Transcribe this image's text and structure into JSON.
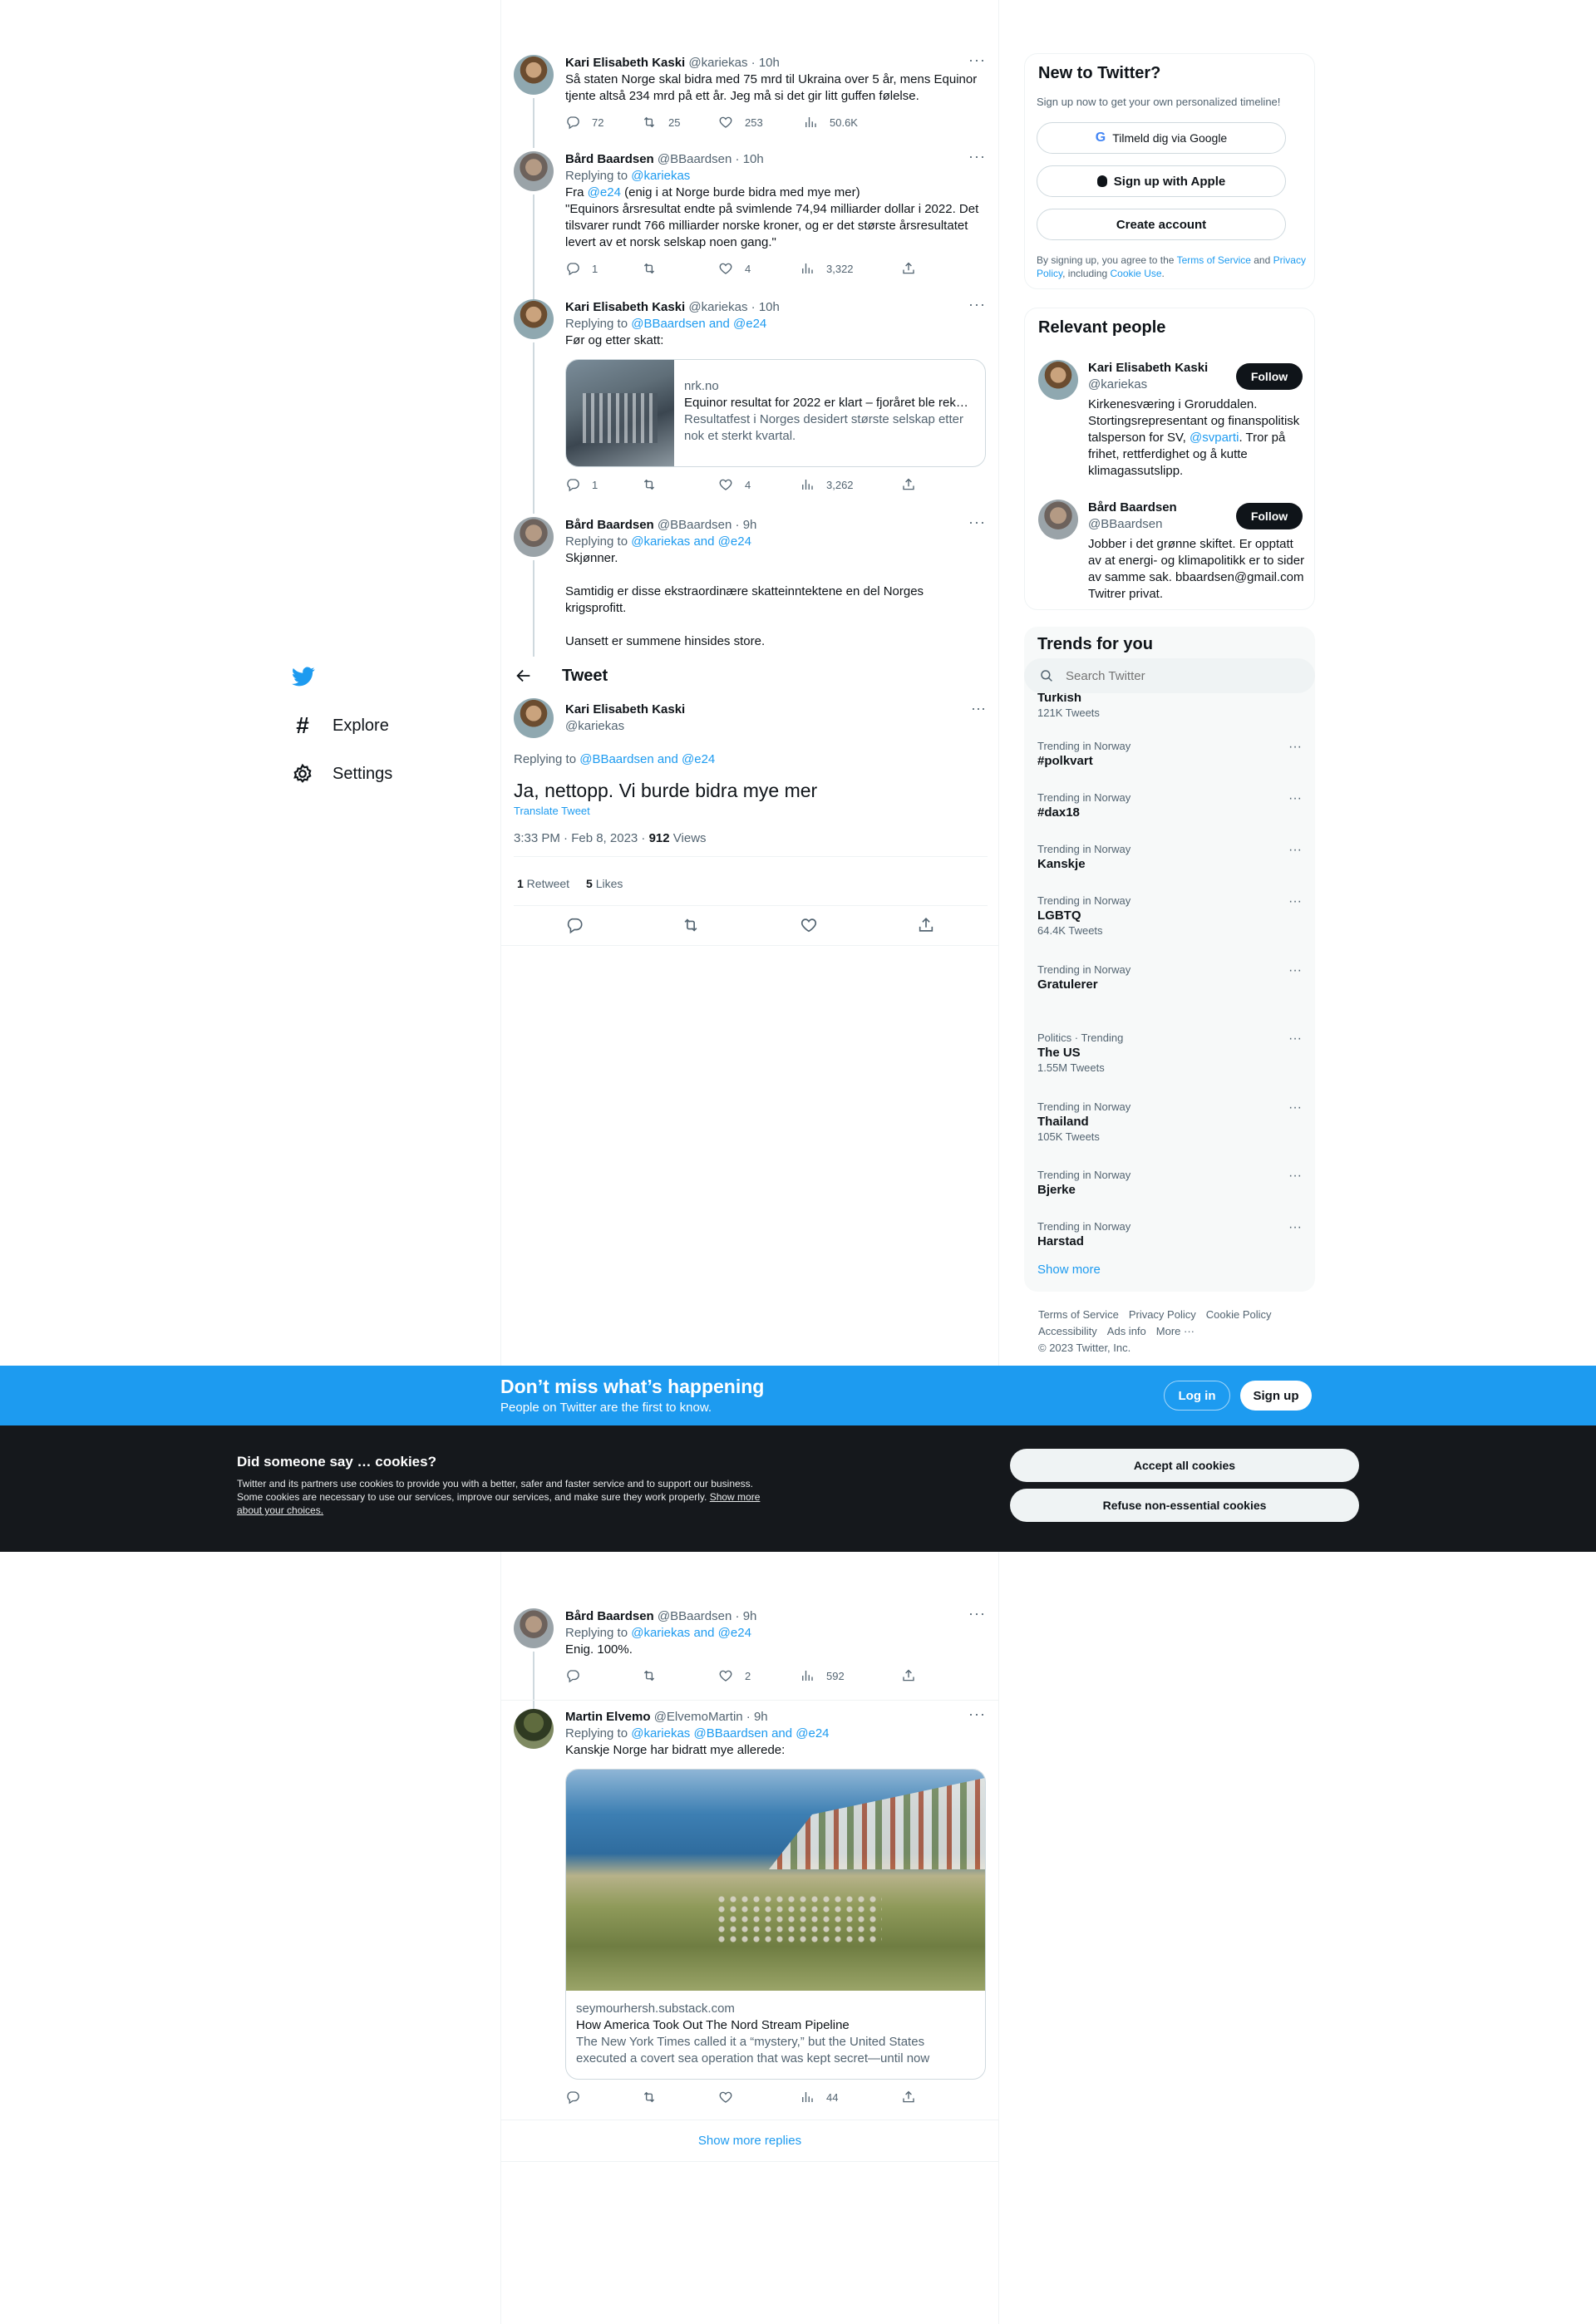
{
  "nav": {
    "explore": "Explore",
    "settings": "Settings"
  },
  "tweet_header": {
    "title": "Tweet"
  },
  "thread": [
    {
      "name": "Kari Elisabeth Kaski",
      "handle": "@kariekas",
      "time": "10h",
      "text": "Så staten Norge skal bidra med 75 mrd til Ukraina over 5 år, mens Equinor tjente altså 234 mrd på ett år. Jeg må si det gir litt guffen følelse.",
      "replies": "72",
      "retweets": "25",
      "likes": "253",
      "views": "50.6K"
    },
    {
      "name": "Bård Baardsen",
      "handle": "@BBaardsen",
      "time": "10h",
      "replying_label": "Replying to",
      "replying_to": "@kariekas",
      "text_pre": "Fra",
      "text_mention": "@e24",
      "text_post": "(enig i at Norge burde bidra med mye mer)",
      "text_quote": "\"Equinors årsresultat endte på svimlende 74,94 milliarder dollar i 2022. Det tilsvarer rundt 766 milliarder norske kroner, og er det største årsresultatet levert av et norsk selskap noen gang.\"",
      "replies": "1",
      "retweets": "",
      "likes": "4",
      "views": "3,322"
    },
    {
      "name": "Kari Elisabeth Kaski",
      "handle": "@kariekas",
      "time": "10h",
      "replying_label": "Replying to",
      "replying_to": "@BBaardsen and @e24",
      "text": "Før og etter skatt:",
      "card": {
        "domain": "nrk.no",
        "title": "Equinor resultat for 2022 er klart – fjoråret ble rek…",
        "desc": "Resultatfest i Norges desidert største selskap etter nok et sterkt kvartal."
      },
      "replies": "1",
      "retweets": "",
      "likes": "4",
      "views": "3,262"
    },
    {
      "name": "Bård Baardsen",
      "handle": "@BBaardsen",
      "time": "9h",
      "replying_label": "Replying to",
      "replying_to": "@kariekas and @e24",
      "p1": "Skjønner.",
      "p2": "Samtidig er disse ekstraordinære skatteinntektene en del Norges krigsprofitt.",
      "p3": "Uansett er summene hinsides store."
    }
  ],
  "main_tweet": {
    "name": "Kari Elisabeth Kaski",
    "handle": "@kariekas",
    "replying_label": "Replying to",
    "replying_to": "@BBaardsen and @e24",
    "text": "Ja, nettopp. Vi burde bidra mye mer",
    "translate": "Translate Tweet",
    "timestamp": "3:33 PM · Feb 8, 2023 · ",
    "views_count": "912",
    "views_label": " Views",
    "retweets_count": "1",
    "retweets_label": " Retweet",
    "likes_count": "5",
    "likes_label": " Likes"
  },
  "replies_below": [
    {
      "name": "Bård Baardsen",
      "handle": "@BBaardsen",
      "time": "9h",
      "replying_label": "Replying to",
      "replying_to": "@kariekas and @e24",
      "text": "Enig. 100%.",
      "replies": "",
      "retweets": "",
      "likes": "2",
      "views": "592"
    },
    {
      "name": "Martin Elvemo",
      "handle": "@ElvemoMartin",
      "time": "9h",
      "replying_label": "Replying to",
      "replying_to": "@kariekas @BBaardsen and @e24",
      "text": "Kanskje Norge har bidratt mye allerede:",
      "card": {
        "domain": "seymourhersh.substack.com",
        "title": "How America Took Out The Nord Stream Pipeline",
        "desc": "The New York Times called it a “mystery,” but the United States executed a covert sea operation that was kept secret—until now"
      },
      "replies": "",
      "retweets": "",
      "likes": "",
      "views": "44"
    }
  ],
  "show_more_replies": "Show more replies",
  "signup": {
    "title": "New to Twitter?",
    "subtitle": "Sign up now to get your own personalized timeline!",
    "google": "Tilmeld dig via Google",
    "apple": "Sign up with Apple",
    "create": "Create account",
    "legal_1": "By signing up, you agree to the ",
    "tos": "Terms of Service",
    "legal_2": " and ",
    "privacy": "Privacy Policy",
    "legal_3": ", including ",
    "cookie": "Cookie Use",
    "legal_4": "."
  },
  "relevant": {
    "title": "Relevant people",
    "people": [
      {
        "name": "Kari Elisabeth Kaski",
        "handle": "@kariekas",
        "follow": "Follow",
        "bio_pre": "Kirkenesværing i Groruddalen. Stortingsrepresentant og finanspolitisk talsperson for SV, ",
        "bio_mention": "@svparti",
        "bio_post": ". Tror på frihet, rettferdighet og å kutte klimagassutslipp."
      },
      {
        "name": "Bård Baardsen",
        "handle": "@BBaardsen",
        "follow": "Follow",
        "bio_pre": "Jobber i det grønne skiftet. Er opptatt av at energi- og klimapolitikk er to sider av samme sak. bbaardsen@gmail.com Twitrer privat.",
        "bio_mention": "",
        "bio_post": ""
      }
    ]
  },
  "search": {
    "placeholder": "Search Twitter"
  },
  "trends": {
    "title": "Trends for you",
    "first": {
      "topic": "Turkish",
      "count": "121K Tweets"
    },
    "items": [
      {
        "ctx": "Trending in Norway",
        "topic": "#polkvart",
        "count": ""
      },
      {
        "ctx": "Trending in Norway",
        "topic": "#dax18",
        "count": ""
      },
      {
        "ctx": "Trending in Norway",
        "topic": "Kanskje",
        "count": ""
      },
      {
        "ctx": "Trending in Norway",
        "topic": "LGBTQ",
        "count": "64.4K Tweets"
      },
      {
        "ctx": "Trending in Norway",
        "topic": "Gratulerer",
        "count": ""
      },
      {
        "ctx": "Politics · Trending",
        "topic": "The US",
        "count": "1.55M Tweets"
      },
      {
        "ctx": "Trending in Norway",
        "topic": "Thailand",
        "count": "105K Tweets"
      },
      {
        "ctx": "Trending in Norway",
        "topic": "Bjerke",
        "count": ""
      },
      {
        "ctx": "Trending in Norway",
        "topic": "Harstad",
        "count": ""
      }
    ],
    "show_more": "Show more"
  },
  "footer": {
    "tos": "Terms of Service",
    "privacy": "Privacy Policy",
    "cookie": "Cookie Policy",
    "accessibility": "Accessibility",
    "ads": "Ads info",
    "more": "More ···",
    "copyright": "© 2023 Twitter, Inc."
  },
  "banner": {
    "title": "Don’t miss what’s happening",
    "subtitle": "People on Twitter are the first to know.",
    "login": "Log in",
    "signup": "Sign up"
  },
  "cookies": {
    "title": "Did someone say … cookies?",
    "text": "Twitter and its partners use cookies to provide you with a better, safer and faster service and to support our business. Some cookies are necessary to use our services, improve our services, and make sure they work properly. ",
    "link": "Show more about your choices.",
    "accept": "Accept all cookies",
    "refuse": "Refuse non-essential cookies"
  },
  "colors": {
    "accent": "#1d9bf0",
    "dark": "#15202b",
    "text": "#0f1419",
    "muted": "#536471"
  }
}
